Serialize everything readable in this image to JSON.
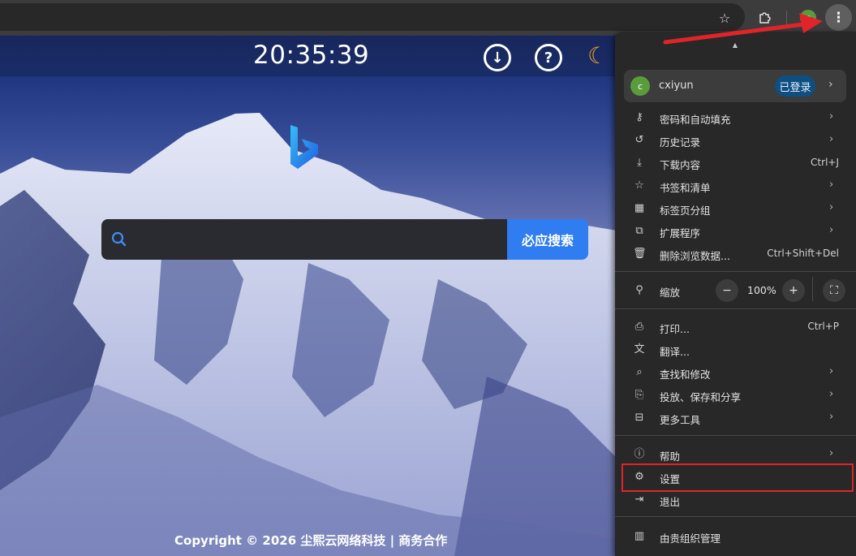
{
  "browser": {
    "bookmark_icon": "star-icon",
    "extensions_icon": "puzzle-icon",
    "profile_initial": "c",
    "menu_icon": "more-vert-icon"
  },
  "page": {
    "clock": "20:35:39",
    "download_icon": "download-icon",
    "help_icon": "help-icon",
    "theme_icon": "moon-icon",
    "search": {
      "button_label": "必应搜索",
      "placeholder": ""
    },
    "copyright": "Copyright © 2026 尘熙云网络科技 | 商务合作"
  },
  "menu": {
    "profile": {
      "initial": "c",
      "name": "cxiyun",
      "badge": "已登录"
    },
    "items": [
      {
        "label": "密码和自动填充",
        "icon": "key-icon",
        "shortcut": "",
        "submenu": true
      },
      {
        "label": "历史记录",
        "icon": "history-icon",
        "shortcut": "",
        "submenu": true
      },
      {
        "label": "下载内容",
        "icon": "download-icon",
        "shortcut": "Ctrl+J",
        "submenu": false
      },
      {
        "label": "书签和清单",
        "icon": "star-icon",
        "shortcut": "",
        "submenu": true
      },
      {
        "label": "标签页分组",
        "icon": "grid-icon",
        "shortcut": "",
        "submenu": true
      },
      {
        "label": "扩展程序",
        "icon": "puzzle-icon",
        "shortcut": "",
        "submenu": true
      },
      {
        "label": "删除浏览数据...",
        "icon": "trash-icon",
        "shortcut": "Ctrl+Shift+Del",
        "submenu": false
      }
    ],
    "zoom": {
      "label": "缩放",
      "minus": "−",
      "value": "100%",
      "plus": "+",
      "icon": "zoom-icon"
    },
    "items2": [
      {
        "label": "打印...",
        "icon": "print-icon",
        "shortcut": "Ctrl+P",
        "submenu": false
      },
      {
        "label": "翻译...",
        "icon": "translate-icon",
        "shortcut": "",
        "submenu": false
      },
      {
        "label": "查找和修改",
        "icon": "find-icon",
        "shortcut": "",
        "submenu": true
      },
      {
        "label": "投放、保存和分享",
        "icon": "cast-icon",
        "shortcut": "",
        "submenu": true
      },
      {
        "label": "更多工具",
        "icon": "toolbox-icon",
        "shortcut": "",
        "submenu": true
      }
    ],
    "items3": [
      {
        "label": "帮助",
        "icon": "help-icon",
        "shortcut": "",
        "submenu": true
      },
      {
        "label": "设置",
        "icon": "gear-icon",
        "shortcut": "",
        "submenu": false
      },
      {
        "label": "退出",
        "icon": "exit-icon",
        "shortcut": "",
        "submenu": false
      }
    ],
    "managed": {
      "label": "由贵组织管理",
      "icon": "building-icon"
    }
  },
  "colors": {
    "accent": "#2f7df0",
    "annotation": "#e0242a",
    "moon": "#f0a020"
  }
}
